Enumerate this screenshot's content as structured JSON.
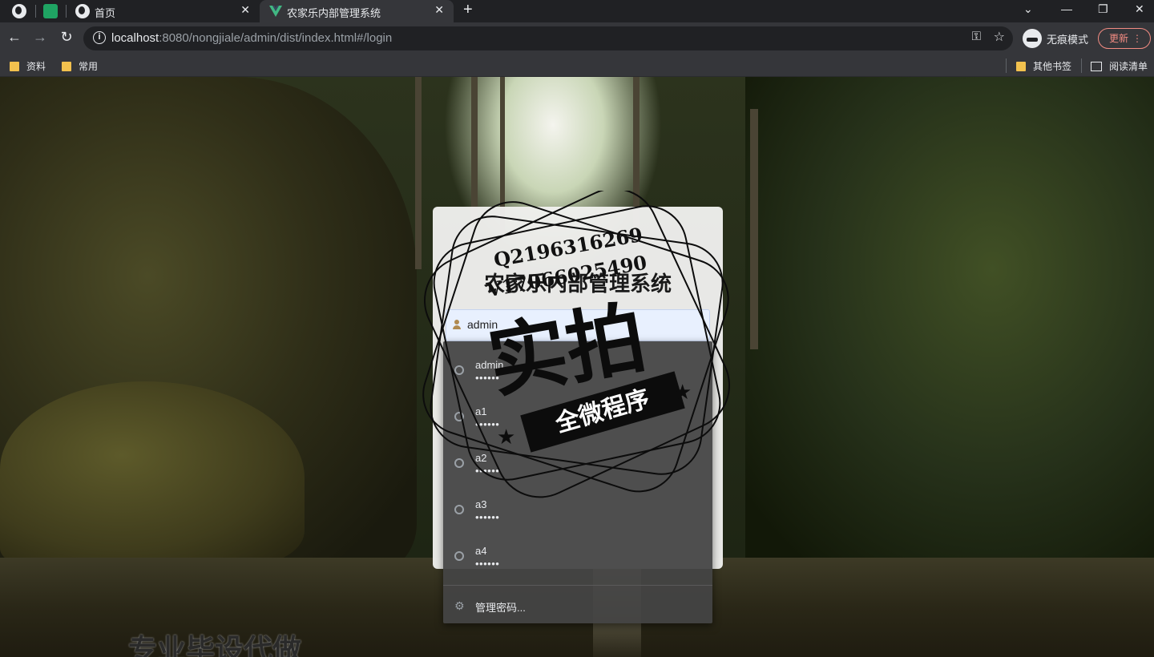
{
  "browser": {
    "tabs": [
      {
        "title": "首页",
        "active": false
      },
      {
        "title": "农家乐内部管理系统",
        "active": true
      }
    ],
    "new_tab": "+",
    "window_controls": {
      "minimize": "—",
      "restore": "❐",
      "close": "✕"
    },
    "url_host": "localhost",
    "url_rest": ":8080/nongjiale/admin/dist/index.html#/login",
    "incognito_label": "无痕模式",
    "update_label": "更新",
    "bookmarks": [
      "资料",
      "常用"
    ],
    "bookmarks_right": [
      "其他书签",
      "阅读清单"
    ]
  },
  "login": {
    "title": "农家乐内部管理系统",
    "username_value": "admin"
  },
  "autofill": {
    "items": [
      {
        "name": "admin",
        "password": "••••••"
      },
      {
        "name": "a1",
        "password": "••••••"
      },
      {
        "name": "a2",
        "password": "••••••"
      },
      {
        "name": "a3",
        "password": "••••••"
      },
      {
        "name": "a4",
        "password": "••••••"
      }
    ],
    "manage_label": "管理密码..."
  },
  "watermark": {
    "line1": "Q2196316269",
    "line2": "V17066025490",
    "big": "实拍",
    "ribbon": "全微程序"
  },
  "banner_text": "专业毕设代做"
}
